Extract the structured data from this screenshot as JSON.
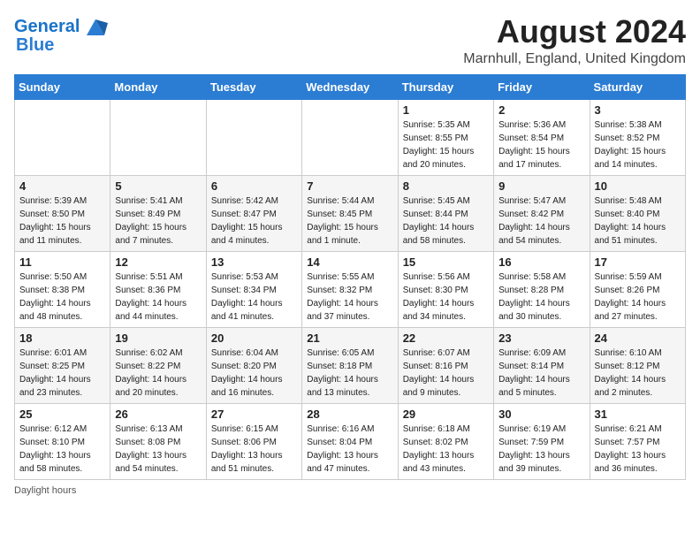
{
  "header": {
    "logo_line1": "General",
    "logo_line2": "Blue",
    "month_year": "August 2024",
    "location": "Marnhull, England, United Kingdom"
  },
  "weekdays": [
    "Sunday",
    "Monday",
    "Tuesday",
    "Wednesday",
    "Thursday",
    "Friday",
    "Saturday"
  ],
  "weeks": [
    [
      {
        "day": "",
        "info": ""
      },
      {
        "day": "",
        "info": ""
      },
      {
        "day": "",
        "info": ""
      },
      {
        "day": "",
        "info": ""
      },
      {
        "day": "1",
        "info": "Sunrise: 5:35 AM\nSunset: 8:55 PM\nDaylight: 15 hours\nand 20 minutes."
      },
      {
        "day": "2",
        "info": "Sunrise: 5:36 AM\nSunset: 8:54 PM\nDaylight: 15 hours\nand 17 minutes."
      },
      {
        "day": "3",
        "info": "Sunrise: 5:38 AM\nSunset: 8:52 PM\nDaylight: 15 hours\nand 14 minutes."
      }
    ],
    [
      {
        "day": "4",
        "info": "Sunrise: 5:39 AM\nSunset: 8:50 PM\nDaylight: 15 hours\nand 11 minutes."
      },
      {
        "day": "5",
        "info": "Sunrise: 5:41 AM\nSunset: 8:49 PM\nDaylight: 15 hours\nand 7 minutes."
      },
      {
        "day": "6",
        "info": "Sunrise: 5:42 AM\nSunset: 8:47 PM\nDaylight: 15 hours\nand 4 minutes."
      },
      {
        "day": "7",
        "info": "Sunrise: 5:44 AM\nSunset: 8:45 PM\nDaylight: 15 hours\nand 1 minute."
      },
      {
        "day": "8",
        "info": "Sunrise: 5:45 AM\nSunset: 8:44 PM\nDaylight: 14 hours\nand 58 minutes."
      },
      {
        "day": "9",
        "info": "Sunrise: 5:47 AM\nSunset: 8:42 PM\nDaylight: 14 hours\nand 54 minutes."
      },
      {
        "day": "10",
        "info": "Sunrise: 5:48 AM\nSunset: 8:40 PM\nDaylight: 14 hours\nand 51 minutes."
      }
    ],
    [
      {
        "day": "11",
        "info": "Sunrise: 5:50 AM\nSunset: 8:38 PM\nDaylight: 14 hours\nand 48 minutes."
      },
      {
        "day": "12",
        "info": "Sunrise: 5:51 AM\nSunset: 8:36 PM\nDaylight: 14 hours\nand 44 minutes."
      },
      {
        "day": "13",
        "info": "Sunrise: 5:53 AM\nSunset: 8:34 PM\nDaylight: 14 hours\nand 41 minutes."
      },
      {
        "day": "14",
        "info": "Sunrise: 5:55 AM\nSunset: 8:32 PM\nDaylight: 14 hours\nand 37 minutes."
      },
      {
        "day": "15",
        "info": "Sunrise: 5:56 AM\nSunset: 8:30 PM\nDaylight: 14 hours\nand 34 minutes."
      },
      {
        "day": "16",
        "info": "Sunrise: 5:58 AM\nSunset: 8:28 PM\nDaylight: 14 hours\nand 30 minutes."
      },
      {
        "day": "17",
        "info": "Sunrise: 5:59 AM\nSunset: 8:26 PM\nDaylight: 14 hours\nand 27 minutes."
      }
    ],
    [
      {
        "day": "18",
        "info": "Sunrise: 6:01 AM\nSunset: 8:25 PM\nDaylight: 14 hours\nand 23 minutes."
      },
      {
        "day": "19",
        "info": "Sunrise: 6:02 AM\nSunset: 8:22 PM\nDaylight: 14 hours\nand 20 minutes."
      },
      {
        "day": "20",
        "info": "Sunrise: 6:04 AM\nSunset: 8:20 PM\nDaylight: 14 hours\nand 16 minutes."
      },
      {
        "day": "21",
        "info": "Sunrise: 6:05 AM\nSunset: 8:18 PM\nDaylight: 14 hours\nand 13 minutes."
      },
      {
        "day": "22",
        "info": "Sunrise: 6:07 AM\nSunset: 8:16 PM\nDaylight: 14 hours\nand 9 minutes."
      },
      {
        "day": "23",
        "info": "Sunrise: 6:09 AM\nSunset: 8:14 PM\nDaylight: 14 hours\nand 5 minutes."
      },
      {
        "day": "24",
        "info": "Sunrise: 6:10 AM\nSunset: 8:12 PM\nDaylight: 14 hours\nand 2 minutes."
      }
    ],
    [
      {
        "day": "25",
        "info": "Sunrise: 6:12 AM\nSunset: 8:10 PM\nDaylight: 13 hours\nand 58 minutes."
      },
      {
        "day": "26",
        "info": "Sunrise: 6:13 AM\nSunset: 8:08 PM\nDaylight: 13 hours\nand 54 minutes."
      },
      {
        "day": "27",
        "info": "Sunrise: 6:15 AM\nSunset: 8:06 PM\nDaylight: 13 hours\nand 51 minutes."
      },
      {
        "day": "28",
        "info": "Sunrise: 6:16 AM\nSunset: 8:04 PM\nDaylight: 13 hours\nand 47 minutes."
      },
      {
        "day": "29",
        "info": "Sunrise: 6:18 AM\nSunset: 8:02 PM\nDaylight: 13 hours\nand 43 minutes."
      },
      {
        "day": "30",
        "info": "Sunrise: 6:19 AM\nSunset: 7:59 PM\nDaylight: 13 hours\nand 39 minutes."
      },
      {
        "day": "31",
        "info": "Sunrise: 6:21 AM\nSunset: 7:57 PM\nDaylight: 13 hours\nand 36 minutes."
      }
    ]
  ],
  "footer": {
    "note": "Daylight hours"
  }
}
